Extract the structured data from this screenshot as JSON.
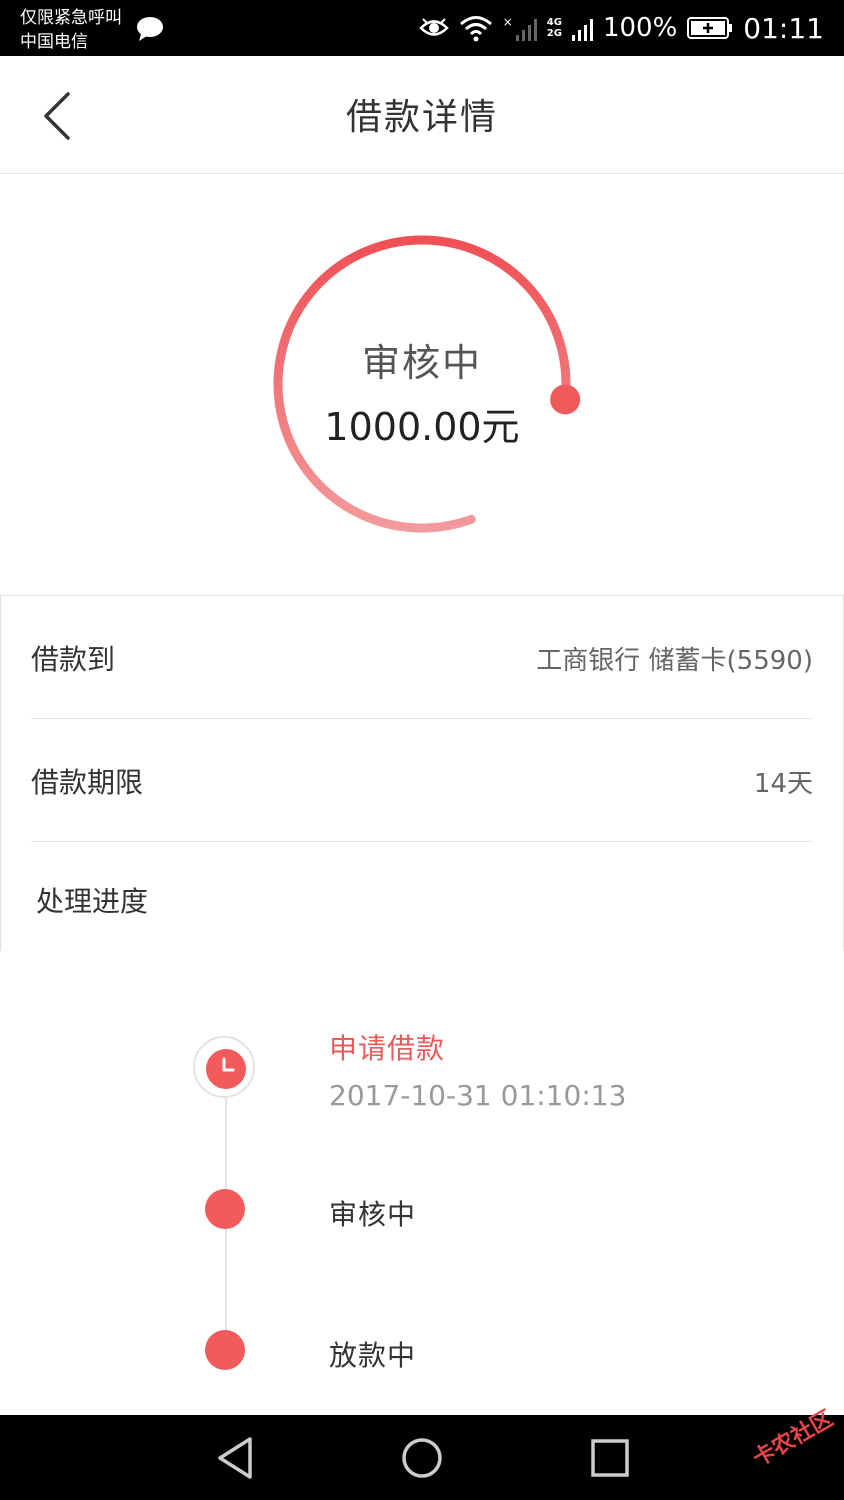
{
  "status_bar": {
    "carrier_line1": "仅限紧急呼叫",
    "carrier_line2": "中国电信",
    "network_top": "4G",
    "network_bottom": "2G",
    "battery": "100%",
    "time": "01:11"
  },
  "header": {
    "title": "借款详情"
  },
  "summary": {
    "status": "审核中",
    "amount": "1000.00元",
    "progress_fraction": 0.8,
    "ring_color": "#ef5a5c"
  },
  "details": [
    {
      "label": "借款到",
      "value": "工商银行 储蓄卡(5590)"
    },
    {
      "label": "借款期限",
      "value": "14天"
    },
    {
      "label": "处理进度",
      "value": ""
    }
  ],
  "timeline": {
    "steps": [
      {
        "title": "申请借款",
        "time": "2017-10-31 01:10:13",
        "active": true
      },
      {
        "title": "审核中"
      },
      {
        "title": "放款中"
      }
    ],
    "accent": "#f25a5c"
  },
  "watermark": "卡农社区"
}
